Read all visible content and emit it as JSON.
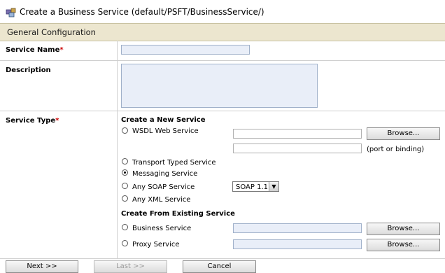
{
  "title": {
    "text": "Create a Business Service (default/PSFT/BusinessService/)",
    "icon": "business-service-icon"
  },
  "section": {
    "title": "General Configuration"
  },
  "form": {
    "service_name": {
      "label": "Service Name",
      "value": ""
    },
    "description": {
      "label": "Description",
      "value": ""
    },
    "service_type": {
      "label": "Service Type",
      "create_new_heading": "Create a New Service",
      "options": {
        "wsdl": "WSDL Web Service",
        "transport": "Transport Typed Service",
        "messaging": "Messaging Service",
        "any_soap": "Any SOAP Service",
        "any_xml": "Any XML Service"
      },
      "port_binding_hint": "(port or binding)",
      "soap_version": "SOAP 1.1",
      "existing_heading": "Create From Existing Service",
      "existing_options": {
        "business": "Business Service",
        "proxy": "Proxy Service"
      },
      "selected": "messaging"
    },
    "required_mark": "*"
  },
  "buttons": {
    "browse": "Browse...",
    "next": "Next >>",
    "last": "Last >>",
    "cancel": "Cancel"
  }
}
